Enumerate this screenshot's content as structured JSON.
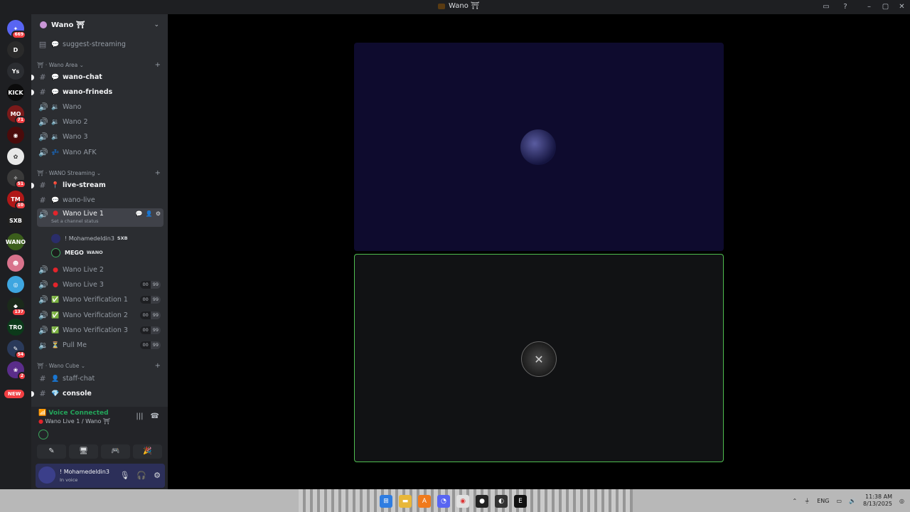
{
  "window": {
    "title": "Wano ⛩",
    "controls": [
      "–",
      "▢",
      "✕"
    ]
  },
  "guilds": [
    {
      "icon": "discord-home-icon",
      "badge": "669",
      "color": "#5865f2",
      "text": "✦"
    },
    {
      "icon": "server-d-icon",
      "badge": "",
      "color": "#2a2a2a",
      "text": "D"
    },
    {
      "icon": "server-ys-icon",
      "badge": "",
      "color": "#2b2d31",
      "text": "Ys"
    },
    {
      "icon": "server-kick-icon",
      "badge": "",
      "color": "#0b0b0b",
      "text": "KICK"
    },
    {
      "icon": "server-mo-icon",
      "badge": "71",
      "color": "#7a1a1a",
      "text": "MO"
    },
    {
      "icon": "server-red-icon",
      "badge": "",
      "color": "#4a0b0b",
      "text": "◉"
    },
    {
      "icon": "server-white-icon",
      "badge": "",
      "color": "#e8e8e8",
      "text": "✿"
    },
    {
      "icon": "server-art-icon",
      "badge": "51",
      "color": "#3a3a3a",
      "text": "✧"
    },
    {
      "icon": "server-tm-icon",
      "badge": "10",
      "color": "#b01818",
      "text": "TM"
    },
    {
      "icon": "server-sxb-icon",
      "badge": "",
      "color": "#202020",
      "text": "SXB"
    },
    {
      "icon": "server-wano-icon",
      "badge": "",
      "color": "#3b5e1c",
      "text": "WANO"
    },
    {
      "icon": "server-kirby-icon",
      "badge": "",
      "color": "#d9738c",
      "text": "☻"
    },
    {
      "icon": "server-blue-icon",
      "badge": "",
      "color": "#3ea6e0",
      "text": "◎"
    },
    {
      "icon": "server-dark-icon",
      "badge": "137",
      "color": "#1b2a1b",
      "text": "◆"
    },
    {
      "icon": "server-tro-icon",
      "badge": "",
      "color": "#0c3a1a",
      "text": "TRO"
    },
    {
      "icon": "server-anime-icon",
      "badge": "54",
      "color": "#2a3a5a",
      "text": "✎"
    },
    {
      "icon": "server-purple-icon",
      "badge": "2",
      "color": "#5a2d8a",
      "text": "❀"
    }
  ],
  "new_badge": "NEW",
  "server": {
    "name": "Wano ⛩"
  },
  "channels": {
    "suggest": "suggest-streaming",
    "cat_area": "Wano Area",
    "wano_chat": "wano-chat",
    "wano_frineds": "wano-frineds",
    "wano": "Wano",
    "wano2": "Wano 2",
    "wano3": "Wano 3",
    "wano_afk": "Wano AFK",
    "cat_streaming": "WANO Streaming",
    "live_stream": "live-stream",
    "wano_live": "wano-live",
    "wano_live1": "Wano Live 1",
    "set_status": "Set a channel status",
    "member1_name": "! Mohamedeldin3",
    "member1_tag": "SXB",
    "member2_name": "MEGO",
    "member2_tag": "WANO",
    "wano_live2": "Wano Live 2",
    "wano_live3": "Wano Live 3",
    "ver1": "Wano Verification 1",
    "ver2": "Wano Verification 2",
    "ver3": "Wano Verification 3",
    "pull_me": "Pull Me",
    "cat_cube": "Wano Cube",
    "staff_chat": "staff-chat",
    "console": "console",
    "count_a": "00",
    "count_b": "99"
  },
  "voice": {
    "status": "Voice Connected",
    "where": "Wano Live 1 / Wano ⛩"
  },
  "user": {
    "name": "! Mohamedeldin3",
    "status": "In voice"
  },
  "taskbar": {
    "lang": "ENG",
    "time": "11:38 AM",
    "date": "8/13/2025"
  },
  "colors": {
    "accent_green": "#4fbe4f",
    "live_red": "#e3242b"
  }
}
